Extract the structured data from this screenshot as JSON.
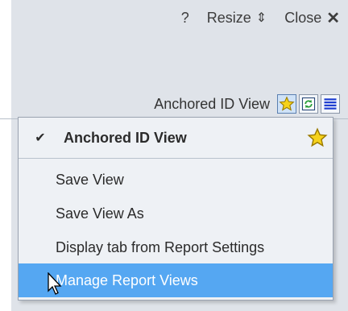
{
  "top_bar": {
    "help_label": "?",
    "resize_label": "Resize",
    "resize_glyph": "⇕",
    "close_label": "Close",
    "close_glyph": "✕"
  },
  "view_bar": {
    "label": "Anchored ID View",
    "buttons": [
      {
        "icon": "star-icon",
        "active": true
      },
      {
        "icon": "refresh-icon",
        "active": false
      },
      {
        "icon": "list-icon",
        "active": false
      }
    ]
  },
  "menu": {
    "header": {
      "check": "✔",
      "label": "Anchored ID View",
      "icon": "star-icon"
    },
    "items": [
      {
        "label": "Save View"
      },
      {
        "label": "Save View As"
      },
      {
        "label": "Display tab from Report Settings"
      },
      {
        "label": "Manage Report Views",
        "highlighted": true
      }
    ]
  },
  "colors": {
    "highlight": "#55a7f2",
    "star_fill": "#f6d21b",
    "star_stroke": "#9a7a00",
    "list_blue": "#1f3fd1",
    "refresh_green": "#2a9d3a"
  }
}
